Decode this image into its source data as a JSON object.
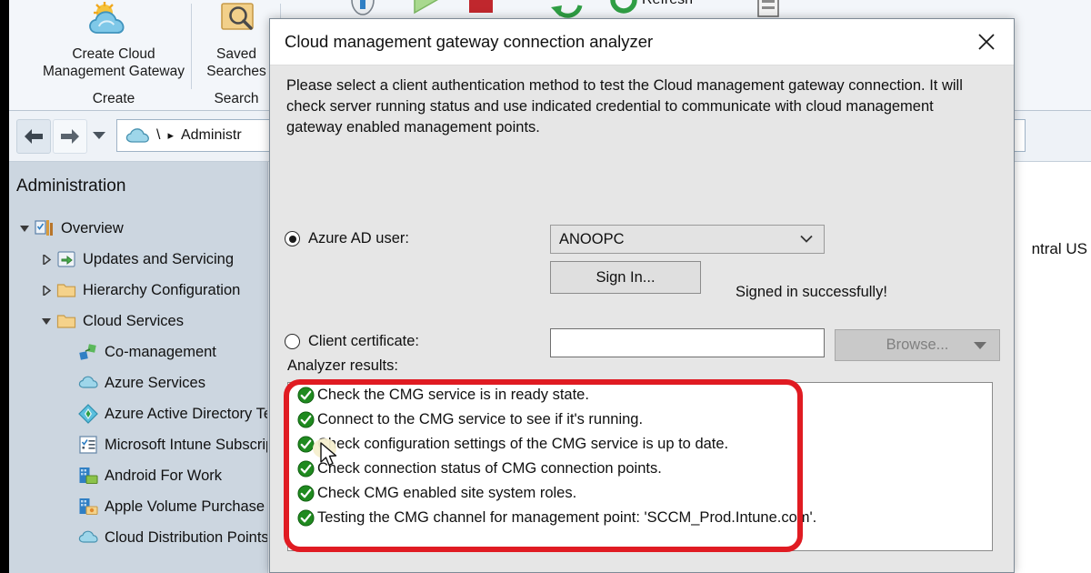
{
  "ribbon": {
    "groups": [
      {
        "title": "Create",
        "button_label": "Create Cloud\nManagement Gateway",
        "icon": "cloud-create-icon"
      },
      {
        "title": "Search",
        "button_label": "Saved\nSearches",
        "icon": "saved-search-icon"
      }
    ],
    "create_button_line1": "Create Cloud",
    "create_button_line2": "Management Gateway",
    "create_group_title": "Create",
    "saved_searches_line1": "Saved",
    "saved_searches_line2": "Searches",
    "search_group_title": "Search",
    "refresh_label": "Refresh"
  },
  "address_bar": {
    "back_icon": "arrow-left-icon",
    "forward_icon": "arrow-right-icon",
    "dropdown_icon": "chevron-down-icon",
    "home_icon": "cloud-icon",
    "separator": "\\",
    "chevron": "▸",
    "path": "Administr"
  },
  "sidebar": {
    "title": "Administration",
    "items": [
      {
        "label": "Overview",
        "icon": "overview-icon",
        "indent": 0,
        "twisty": "expanded"
      },
      {
        "label": "Updates and Servicing",
        "icon": "updates-icon",
        "indent": 1,
        "twisty": "collapsed"
      },
      {
        "label": "Hierarchy Configuration",
        "icon": "folder-icon",
        "indent": 1,
        "twisty": "collapsed"
      },
      {
        "label": "Cloud Services",
        "icon": "folder-icon",
        "indent": 1,
        "twisty": "expanded"
      },
      {
        "label": "Co-management",
        "icon": "comanagement-icon",
        "indent": 2,
        "twisty": "none"
      },
      {
        "label": "Azure Services",
        "icon": "cloud-icon",
        "indent": 2,
        "twisty": "none"
      },
      {
        "label": "Azure Active Directory Tena",
        "icon": "azure-ad-icon",
        "indent": 2,
        "twisty": "none"
      },
      {
        "label": "Microsoft Intune Subscripti",
        "icon": "intune-icon",
        "indent": 2,
        "twisty": "none"
      },
      {
        "label": "Android For Work",
        "icon": "android-work-icon",
        "indent": 2,
        "twisty": "none"
      },
      {
        "label": "Apple Volume Purchase Pro",
        "icon": "apple-vpp-icon",
        "indent": 2,
        "twisty": "none"
      },
      {
        "label": "Cloud Distribution Points",
        "icon": "cloud-icon",
        "indent": 2,
        "twisty": "none"
      }
    ]
  },
  "content": {
    "region_text": "ntral US"
  },
  "dialog": {
    "title": "Cloud management gateway connection analyzer",
    "close_icon": "close-icon",
    "description": "Please select a client authentication method to test the Cloud management gateway connection. It will check server running status and use indicated credential to communicate with cloud management gateway enabled management points.",
    "auth": {
      "azure_ad": {
        "label": "Azure AD user:",
        "selected": true,
        "combo_value": "ANOOPC",
        "combo_icon": "chevron-down-icon"
      },
      "sign_in_button": "Sign In...",
      "sign_in_status": "Signed in successfully!",
      "client_certificate": {
        "label": "Client certificate:",
        "selected": false,
        "textbox_value": "",
        "browse_button": "Browse...",
        "browse_disabled": true,
        "browse_icon": "triangle-down-icon"
      }
    },
    "results_label": "Analyzer results:",
    "results": [
      {
        "status": "success",
        "text": "Check the CMG service is in ready state."
      },
      {
        "status": "success",
        "text": "Connect to the CMG service to see if it's running."
      },
      {
        "status": "success",
        "text": "Check configuration settings of the CMG service is up to date."
      },
      {
        "status": "success",
        "text": "Check connection status of CMG connection points."
      },
      {
        "status": "success",
        "text": "Check CMG enabled site system roles."
      },
      {
        "status": "success",
        "text": "Testing the CMG channel for management point: 'SCCM_Prod.Intune.com'."
      }
    ]
  },
  "annotation": {
    "shape": "rounded-rectangle",
    "color": "#e01b22"
  },
  "colors": {
    "success_green": "#1f8a1f",
    "annotation_red": "#e01b22",
    "dialog_bg": "#e6e6e6",
    "sidebar_bg": "#ccd6e0",
    "ribbon_bg": "#f3f6fa"
  }
}
